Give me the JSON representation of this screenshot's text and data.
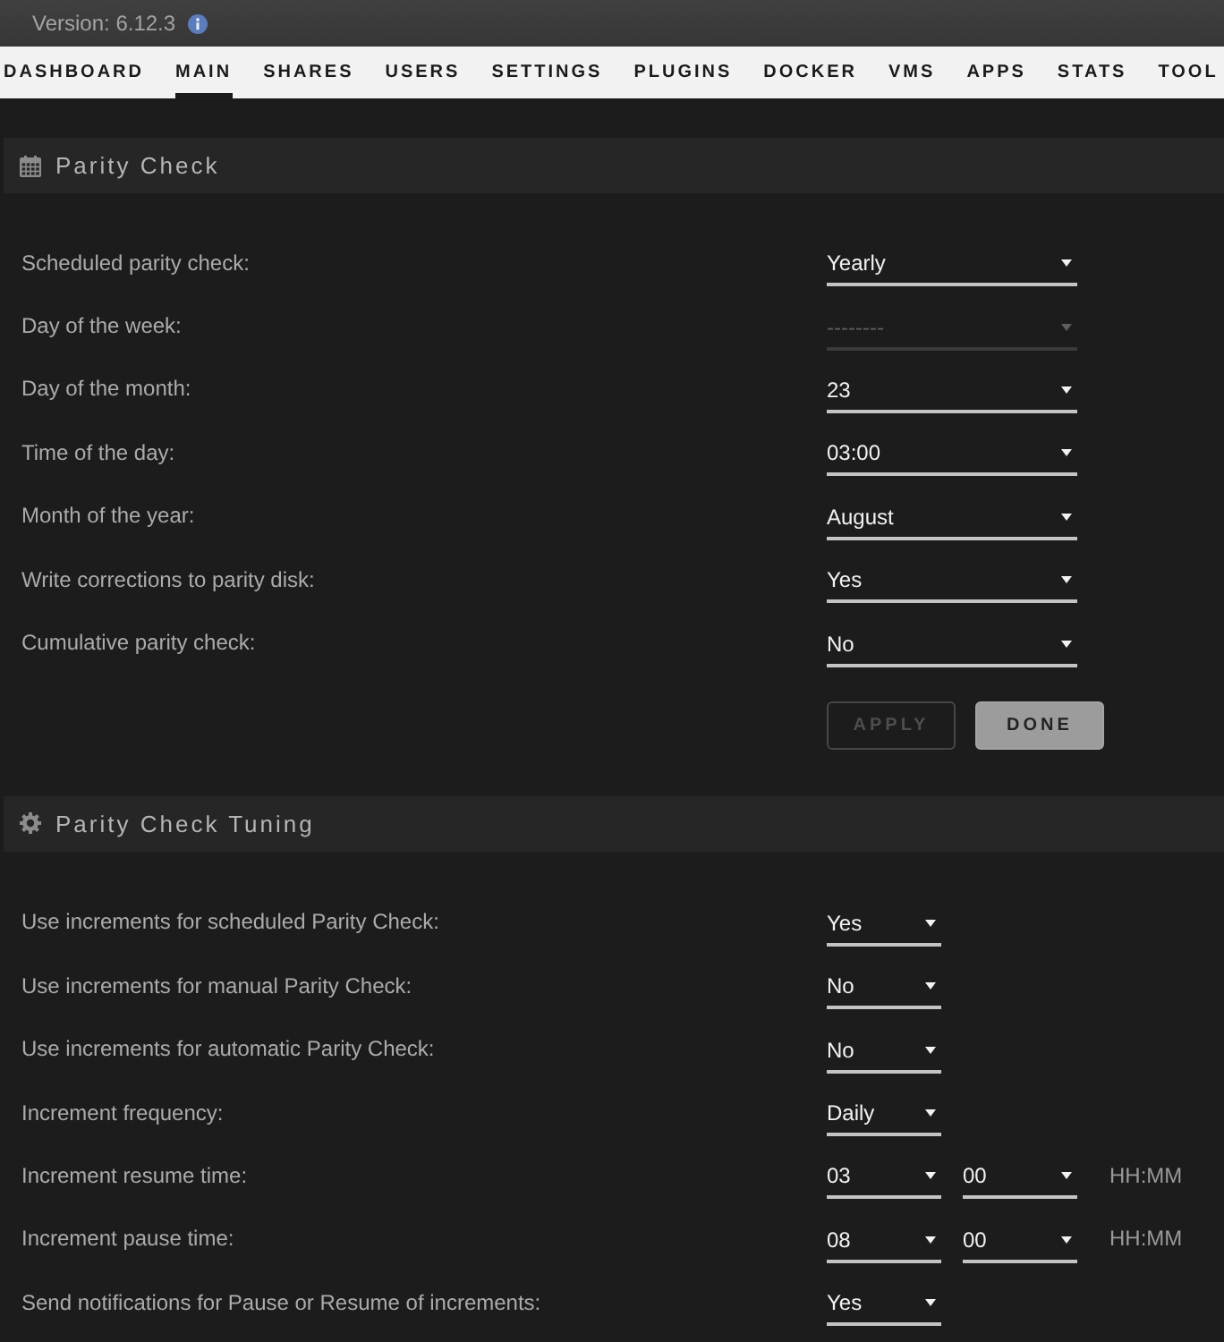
{
  "top_bar": {
    "version": "Version: 6.12.3"
  },
  "nav": [
    {
      "label": "DASHBOARD",
      "selected": false
    },
    {
      "label": "MAIN",
      "selected": true
    },
    {
      "label": "SHARES",
      "selected": false
    },
    {
      "label": "USERS",
      "selected": false
    },
    {
      "label": "SETTINGS",
      "selected": false
    },
    {
      "label": "PLUGINS",
      "selected": false
    },
    {
      "label": "DOCKER",
      "selected": false
    },
    {
      "label": "VMS",
      "selected": false
    },
    {
      "label": "APPS",
      "selected": false
    },
    {
      "label": "STATS",
      "selected": false
    },
    {
      "label": "TOOL",
      "selected": false
    }
  ],
  "sections": [
    {
      "title": "Parity Check",
      "rows": [
        {
          "label": "Scheduled parity check:",
          "selects": [
            {
              "value": "Yearly",
              "disabled": false
            }
          ]
        },
        {
          "label": "Day of the week:",
          "selects": [
            {
              "value": "--------",
              "disabled": true
            }
          ]
        },
        {
          "label": "Day of the month:",
          "selects": [
            {
              "value": "23",
              "disabled": false
            }
          ]
        },
        {
          "label": "Time of the day:",
          "selects": [
            {
              "value": "03:00",
              "disabled": false
            }
          ]
        },
        {
          "label": "Month of the year:",
          "selects": [
            {
              "value": "August",
              "disabled": false
            }
          ]
        },
        {
          "label": "Write corrections to parity disk:",
          "selects": [
            {
              "value": "Yes",
              "disabled": false
            }
          ]
        },
        {
          "label": "Cumulative parity check:",
          "selects": [
            {
              "value": "No",
              "disabled": false
            }
          ]
        }
      ],
      "buttons": [
        {
          "label": "APPLY",
          "disabled": true
        },
        {
          "label": "DONE",
          "disabled": false
        }
      ]
    },
    {
      "title": "Parity Check Tuning",
      "rows": [
        {
          "label": "Use increments for scheduled Parity Check:",
          "selects": [
            {
              "value": "Yes",
              "disabled": false
            }
          ]
        },
        {
          "label": "Use increments for manual Parity Check:",
          "selects": [
            {
              "value": "No",
              "disabled": false
            }
          ]
        },
        {
          "label": "Use increments for automatic Parity Check:",
          "selects": [
            {
              "value": "No",
              "disabled": false
            }
          ]
        },
        {
          "label": "Increment frequency:",
          "selects": [
            {
              "value": "Daily",
              "disabled": false
            }
          ]
        },
        {
          "label": "Increment resume time:",
          "selects": [
            {
              "value": "03",
              "disabled": false
            },
            {
              "value": "00",
              "disabled": false
            }
          ],
          "unit": "HH:MM"
        },
        {
          "label": "Increment pause time:",
          "selects": [
            {
              "value": "08",
              "disabled": false
            },
            {
              "value": "00",
              "disabled": false
            }
          ],
          "unit": "HH:MM"
        },
        {
          "label": "Send notifications for Pause or Resume of increments:",
          "selects": [
            {
              "value": "Yes",
              "disabled": false
            }
          ]
        }
      ]
    }
  ]
}
